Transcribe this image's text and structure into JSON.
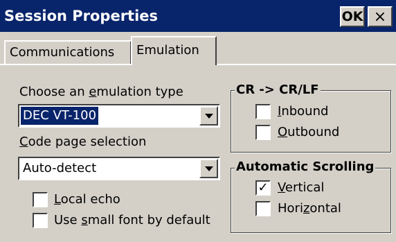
{
  "window": {
    "title": "Session Properties",
    "ok_label": "OK",
    "close_label": "×"
  },
  "tabs": [
    {
      "label": "Communications",
      "active": false
    },
    {
      "label": "Emulation",
      "active": true
    }
  ],
  "emulation": {
    "label_pre": "Choose an ",
    "label_ul": "e",
    "label_post": "mulation type",
    "value": "DEC VT-100"
  },
  "code_page": {
    "label_ul": "C",
    "label_post": "ode page selection",
    "value": "Auto-detect"
  },
  "options": {
    "local_echo": {
      "ul": "L",
      "post": "ocal echo",
      "checked": false
    },
    "small_font": {
      "pre": "Use ",
      "ul": "s",
      "post": "mall font by default",
      "checked": false
    }
  },
  "crlf_group": {
    "title": "CR -> CR/LF",
    "inbound": {
      "ul": "I",
      "post": "nbound",
      "checked": false
    },
    "outbound": {
      "ul": "O",
      "post": "utbound",
      "checked": false
    }
  },
  "scroll_group": {
    "title": "Automatic Scrolling",
    "vertical": {
      "ul": "V",
      "post": "ertical",
      "checked": true,
      "mark": "✓"
    },
    "horizontal": {
      "pre": "Hori",
      "ul": "z",
      "post": "ontal",
      "checked": false
    }
  },
  "colors": {
    "titlebar": "#08246b",
    "face": "#d4d0c8",
    "selection": "#08246b"
  }
}
